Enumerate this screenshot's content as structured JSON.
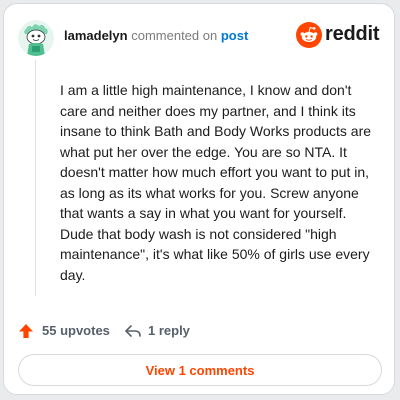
{
  "header": {
    "username": "lamadelyn",
    "action_text": "commented on",
    "post_link": "post",
    "brand": "reddit"
  },
  "comment": {
    "text": "I am a little high maintenance, I know and don't care and neither does my partner, and I think its insane to think Bath and Body Works products are what put her over the edge. You are so NTA. It doesn't matter how much effort you want to put in, as long as its what works for you. Screw anyone that wants a say in what you want for yourself. Dude that body wash is not considered \"high maintenance\", it's what like 50% of girls use every day."
  },
  "actions": {
    "upvotes": "55 upvotes",
    "replies": "1 reply"
  },
  "footer": {
    "view_comments": "View 1 comments"
  },
  "colors": {
    "accent": "#ff4500",
    "link": "#0079d3",
    "avatar_bg": "#dff4ea"
  },
  "icons": {
    "avatar": "snoo-avatar",
    "brand": "reddit-logo-icon",
    "upvote": "upvote-arrow-icon",
    "reply": "reply-arrow-icon"
  }
}
